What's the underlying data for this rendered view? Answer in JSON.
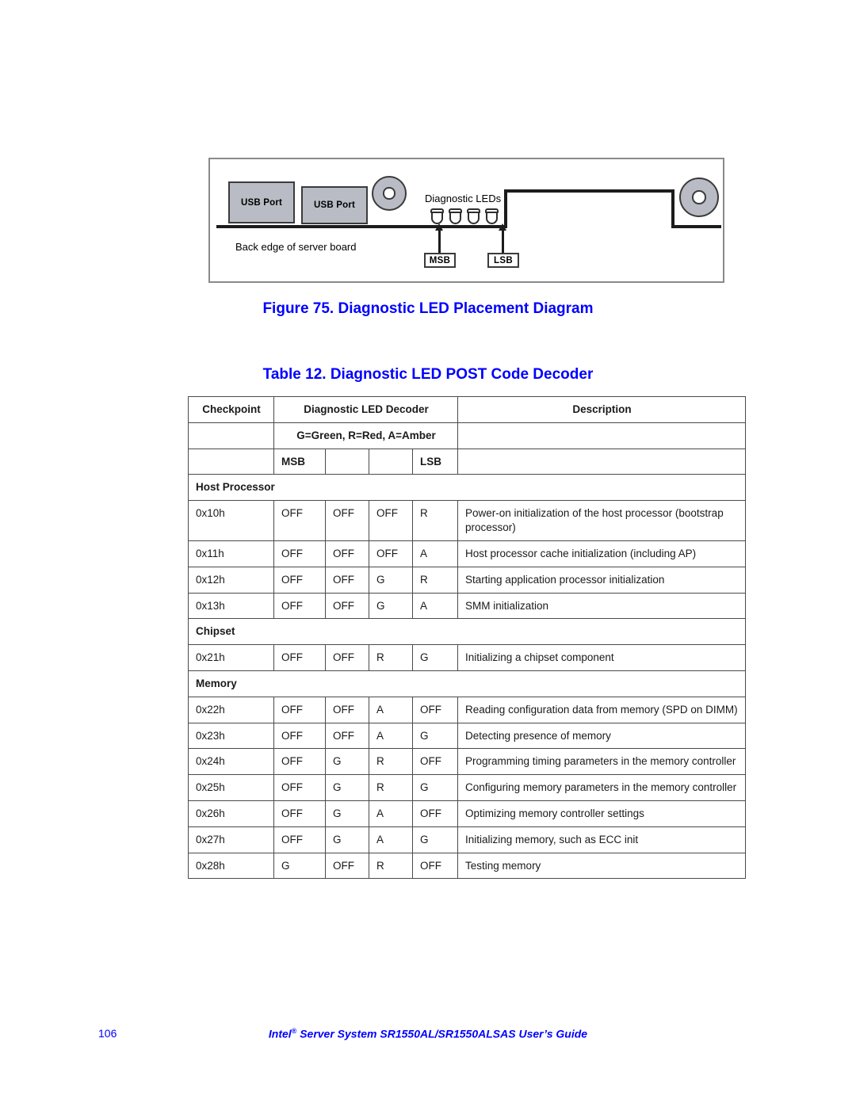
{
  "figure": {
    "box_label_usb_1": "USB Port",
    "box_label_usb_2": "USB Port",
    "diagnostic_leds_label": "Diagnostic LEDs",
    "back_edge_label": "Back edge of server board",
    "callout_msb": "MSB",
    "callout_lsb": "LSB",
    "caption": "Figure 75. Diagnostic LED Placement Diagram"
  },
  "table": {
    "caption": "Table 12. Diagnostic LED POST Code Decoder",
    "headers": {
      "checkpoint": "Checkpoint",
      "decoder": "Diagnostic LED Decoder",
      "description": "Description",
      "legend": "G=Green, R=Red, A=Amber",
      "msb": "MSB",
      "lsb": "LSB"
    },
    "sections": [
      {
        "name": "Host Processor",
        "rows": [
          {
            "checkpoint": "0x10h",
            "led1": "OFF",
            "led2": "OFF",
            "led3": "OFF",
            "led4": "R",
            "description": "Power-on initialization of the host processor (bootstrap processor)"
          },
          {
            "checkpoint": "0x11h",
            "led1": "OFF",
            "led2": "OFF",
            "led3": "OFF",
            "led4": "A",
            "description": "Host processor cache initialization (including AP)"
          },
          {
            "checkpoint": "0x12h",
            "led1": "OFF",
            "led2": "OFF",
            "led3": "G",
            "led4": "R",
            "description": "Starting application processor initialization"
          },
          {
            "checkpoint": "0x13h",
            "led1": "OFF",
            "led2": "OFF",
            "led3": "G",
            "led4": "A",
            "description": "SMM initialization"
          }
        ]
      },
      {
        "name": "Chipset",
        "rows": [
          {
            "checkpoint": "0x21h",
            "led1": "OFF",
            "led2": "OFF",
            "led3": "R",
            "led4": "G",
            "description": "Initializing a chipset component"
          }
        ]
      },
      {
        "name": "Memory",
        "rows": [
          {
            "checkpoint": "0x22h",
            "led1": "OFF",
            "led2": "OFF",
            "led3": "A",
            "led4": "OFF",
            "description": "Reading configuration data from memory (SPD on DIMM)"
          },
          {
            "checkpoint": "0x23h",
            "led1": "OFF",
            "led2": "OFF",
            "led3": "A",
            "led4": "G",
            "description": "Detecting presence of memory"
          },
          {
            "checkpoint": "0x24h",
            "led1": "OFF",
            "led2": "G",
            "led3": "R",
            "led4": "OFF",
            "description": "Programming timing parameters in the memory controller"
          },
          {
            "checkpoint": "0x25h",
            "led1": "OFF",
            "led2": "G",
            "led3": "R",
            "led4": "G",
            "description": "Configuring memory parameters in the memory controller"
          },
          {
            "checkpoint": "0x26h",
            "led1": "OFF",
            "led2": "G",
            "led3": "A",
            "led4": "OFF",
            "description": "Optimizing memory controller settings"
          },
          {
            "checkpoint": "0x27h",
            "led1": "OFF",
            "led2": "G",
            "led3": "A",
            "led4": "G",
            "description": "Initializing memory, such as ECC init"
          },
          {
            "checkpoint": "0x28h",
            "led1": "G",
            "led2": "OFF",
            "led3": "R",
            "led4": "OFF",
            "description": "Testing memory"
          }
        ]
      }
    ]
  },
  "footer": {
    "page_number": "106",
    "guide_prefix": "Intel",
    "guide_mark": "®",
    "guide_suffix": " Server System SR1550AL/SR1550ALSAS User’s Guide"
  },
  "colors": {
    "accent_blue": "#0000ff",
    "part_gray": "#b9bcc4",
    "line_dark": "#1c1c1c"
  }
}
